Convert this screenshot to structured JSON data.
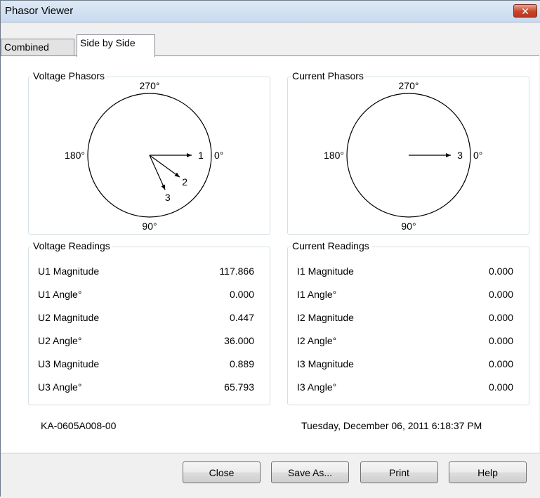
{
  "window": {
    "title": "Phasor Viewer",
    "close_glyph": "✕"
  },
  "tabs": [
    {
      "label": "Combined",
      "active": false
    },
    {
      "label": "Side by Side",
      "active": true
    }
  ],
  "voltage_phasors": {
    "title": "Voltage Phasors",
    "angle_labels": {
      "top": "270°",
      "left": "180°",
      "right": "0°",
      "bottom": "90°"
    },
    "vectors": [
      {
        "label": "1",
        "magnitude": 117.866,
        "angle_deg": 0.0
      },
      {
        "label": "2",
        "magnitude": 0.447,
        "angle_deg": 36.0
      },
      {
        "label": "3",
        "magnitude": 0.889,
        "angle_deg": 65.793
      }
    ]
  },
  "current_phasors": {
    "title": "Current Phasors",
    "angle_labels": {
      "top": "270°",
      "left": "180°",
      "right": "0°",
      "bottom": "90°"
    },
    "vectors": [
      {
        "label": "3",
        "magnitude": 0.0,
        "angle_deg": 0.0
      }
    ]
  },
  "voltage_readings": {
    "title": "Voltage Readings",
    "rows": [
      {
        "label": "U1 Magnitude",
        "value": "117.866"
      },
      {
        "label": "U1 Angle°",
        "value": "0.000"
      },
      {
        "label": "U2 Magnitude",
        "value": "0.447"
      },
      {
        "label": "U2 Angle°",
        "value": "36.000"
      },
      {
        "label": "U3 Magnitude",
        "value": "0.889"
      },
      {
        "label": "U3 Angle°",
        "value": "65.793"
      }
    ]
  },
  "current_readings": {
    "title": "Current Readings",
    "rows": [
      {
        "label": "I1 Magnitude",
        "value": "0.000"
      },
      {
        "label": "I1 Angle°",
        "value": "0.000"
      },
      {
        "label": "I2 Magnitude",
        "value": "0.000"
      },
      {
        "label": "I2 Angle°",
        "value": "0.000"
      },
      {
        "label": "I3 Magnitude",
        "value": "0.000"
      },
      {
        "label": "I3 Angle°",
        "value": "0.000"
      }
    ]
  },
  "footer": {
    "device_id": "KA-0605A008-00",
    "timestamp": "Tuesday, December 06, 2011 6:18:37 PM"
  },
  "buttons": {
    "close": "Close",
    "save_as": "Save As...",
    "print": "Print",
    "help": "Help"
  }
}
